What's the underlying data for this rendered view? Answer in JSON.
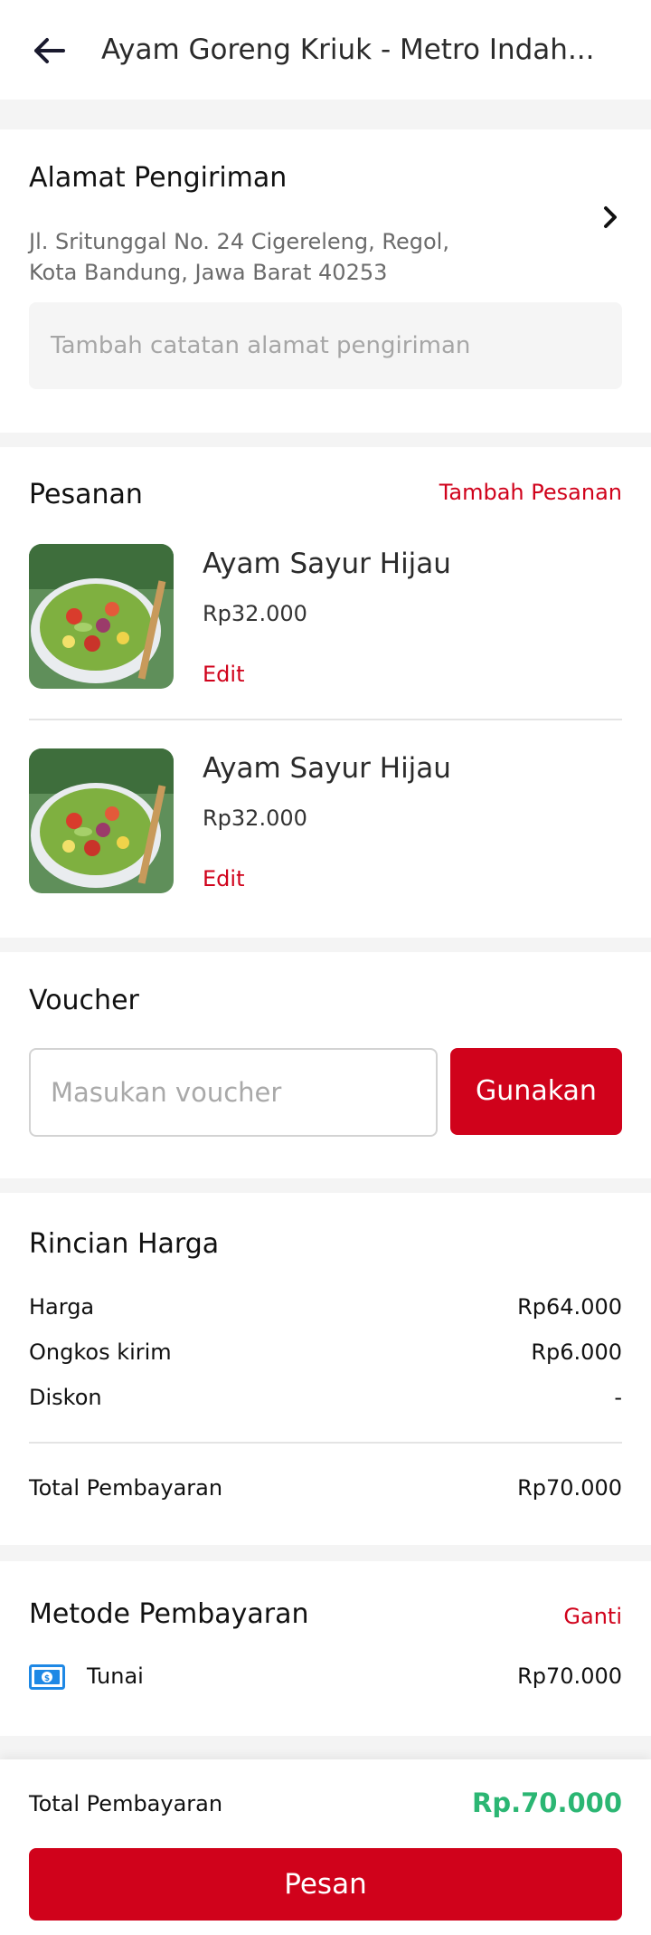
{
  "header": {
    "title": "Ayam Goreng Kriuk - Metro Indah..."
  },
  "address": {
    "title": "Alamat Pengiriman",
    "line1": "Jl. Sritunggal No. 24 Cigereleng, Regol,",
    "line2": "Kota Bandung, Jawa Barat 40253",
    "note_placeholder": "Tambah catatan alamat pengiriman"
  },
  "orders": {
    "title": "Pesanan",
    "add_label": "Tambah Pesanan",
    "items": [
      {
        "name": "Ayam Sayur Hijau",
        "price": "Rp32.000",
        "edit_label": "Edit"
      },
      {
        "name": "Ayam Sayur Hijau",
        "price": "Rp32.000",
        "edit_label": "Edit"
      }
    ]
  },
  "voucher": {
    "title": "Voucher",
    "placeholder": "Masukan voucher",
    "apply_label": "Gunakan"
  },
  "price_details": {
    "title": "Rincian Harga",
    "rows": [
      {
        "label": "Harga",
        "value": "Rp64.000"
      },
      {
        "label": "Ongkos kirim",
        "value": "Rp6.000"
      },
      {
        "label": "Diskon",
        "value": "-"
      }
    ],
    "total_label": "Total Pembayaran",
    "total_value": "Rp70.000"
  },
  "payment": {
    "title": "Metode Pembayaran",
    "change_label": "Ganti",
    "method_icon": "cash-icon",
    "method_label": "Tunai",
    "method_value": "Rp70.000"
  },
  "bottom": {
    "total_label": "Total Pembayaran",
    "total_value": "Rp.70.000",
    "order_label": "Pesan"
  },
  "colors": {
    "accent": "#d0021b",
    "total_green": "#2bb673",
    "cash_icon": "#1e88e5"
  }
}
